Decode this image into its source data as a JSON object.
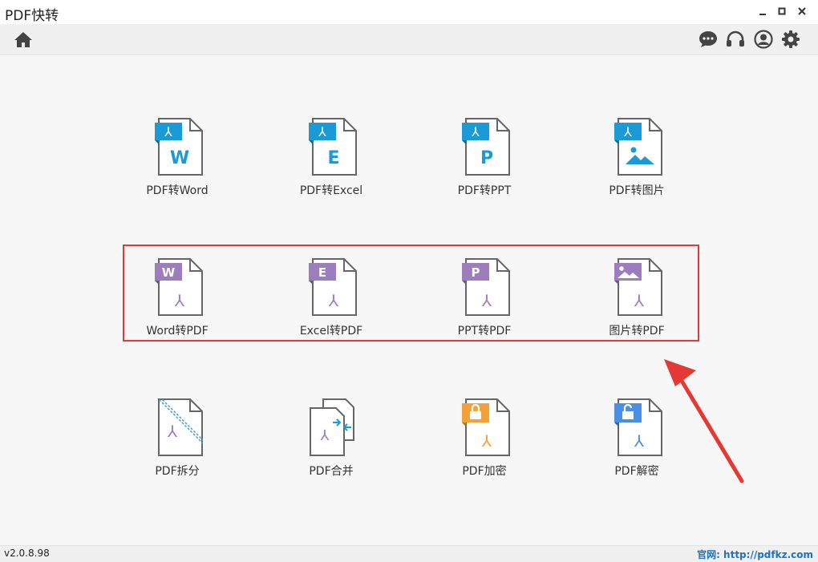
{
  "app": {
    "title": "PDF快转"
  },
  "window_controls": [
    "minimize",
    "maximize",
    "close"
  ],
  "toolbar": {
    "left_icons": [
      "home-icon"
    ],
    "right_icons": [
      "chat-icon",
      "headset-icon",
      "user-icon",
      "gear-icon"
    ]
  },
  "tiles": {
    "row1": [
      {
        "label": "PDF转Word",
        "letter": "W",
        "badge_color": "#1a9ad6",
        "icon": "pdf-to-word-icon"
      },
      {
        "label": "PDF转Excel",
        "letter": "E",
        "badge_color": "#1a9ad6",
        "icon": "pdf-to-excel-icon"
      },
      {
        "label": "PDF转PPT",
        "letter": "P",
        "badge_color": "#1a9ad6",
        "icon": "pdf-to-ppt-icon"
      },
      {
        "label": "PDF转图片",
        "letter": "",
        "badge_color": "#1a9ad6",
        "icon": "pdf-to-image-icon"
      }
    ],
    "row2": [
      {
        "label": "Word转PDF",
        "letter": "W",
        "badge_color": "#9c7dbe",
        "icon": "word-to-pdf-icon"
      },
      {
        "label": "Excel转PDF",
        "letter": "E",
        "badge_color": "#9c7dbe",
        "icon": "excel-to-pdf-icon"
      },
      {
        "label": "PPT转PDF",
        "letter": "P",
        "badge_color": "#9c7dbe",
        "icon": "ppt-to-pdf-icon"
      },
      {
        "label": "图片转PDF",
        "letter": "",
        "badge_color": "#9c7dbe",
        "icon": "image-to-pdf-icon"
      }
    ],
    "row3": [
      {
        "label": "PDF拆分",
        "icon": "pdf-split-icon"
      },
      {
        "label": "PDF合并",
        "icon": "pdf-merge-icon"
      },
      {
        "label": "PDF加密",
        "badge_color": "#f5a13a",
        "icon": "pdf-encrypt-icon"
      },
      {
        "label": "PDF解密",
        "badge_color": "#4a8ee6",
        "icon": "pdf-decrypt-icon"
      }
    ]
  },
  "annotation": {
    "highlight_color": "#e53935"
  },
  "status": {
    "version": "v2.0.8.98",
    "site": "官网: http://pdfkz.com"
  }
}
